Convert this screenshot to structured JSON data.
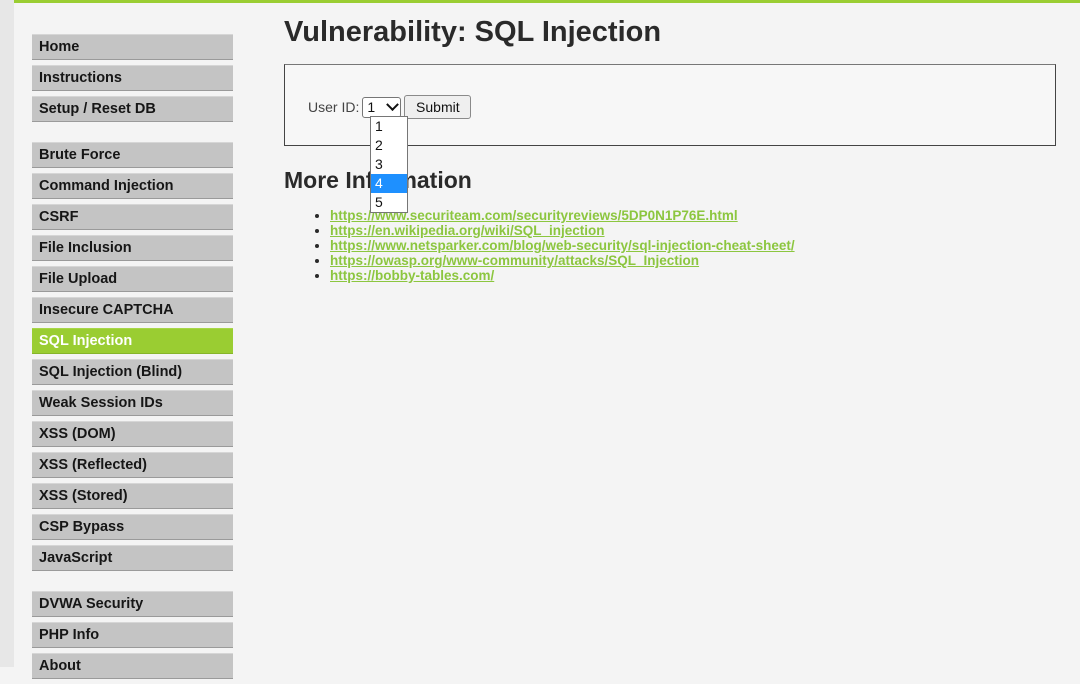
{
  "theme": {
    "accent": "#9acd32",
    "link_color": "#8cc63f",
    "highlight": "#1e90ff"
  },
  "sidebar": {
    "groups": [
      {
        "items": [
          {
            "label": "Home"
          },
          {
            "label": "Instructions"
          },
          {
            "label": "Setup / Reset DB"
          }
        ]
      },
      {
        "items": [
          {
            "label": "Brute Force"
          },
          {
            "label": "Command Injection"
          },
          {
            "label": "CSRF"
          },
          {
            "label": "File Inclusion"
          },
          {
            "label": "File Upload"
          },
          {
            "label": "Insecure CAPTCHA"
          },
          {
            "label": "SQL Injection",
            "active": true
          },
          {
            "label": "SQL Injection (Blind)"
          },
          {
            "label": "Weak Session IDs"
          },
          {
            "label": "XSS (DOM)"
          },
          {
            "label": "XSS (Reflected)"
          },
          {
            "label": "XSS (Stored)"
          },
          {
            "label": "CSP Bypass"
          },
          {
            "label": "JavaScript"
          }
        ]
      },
      {
        "items": [
          {
            "label": "DVWA Security"
          },
          {
            "label": "PHP Info"
          },
          {
            "label": "About"
          }
        ]
      }
    ]
  },
  "main": {
    "title": "Vulnerability: SQL Injection",
    "form": {
      "label": "User ID:",
      "selected_value": "1",
      "options": [
        "1",
        "2",
        "3",
        "4",
        "5"
      ],
      "highlighted_option": "4",
      "submit_label": "Submit"
    },
    "more_info": {
      "heading": "More Information",
      "links": [
        "https://www.securiteam.com/securityreviews/5DP0N1P76E.html",
        "https://en.wikipedia.org/wiki/SQL_injection",
        "https://www.netsparker.com/blog/web-security/sql-injection-cheat-sheet/",
        "https://owasp.org/www-community/attacks/SQL_Injection",
        "https://bobby-tables.com/"
      ]
    }
  }
}
